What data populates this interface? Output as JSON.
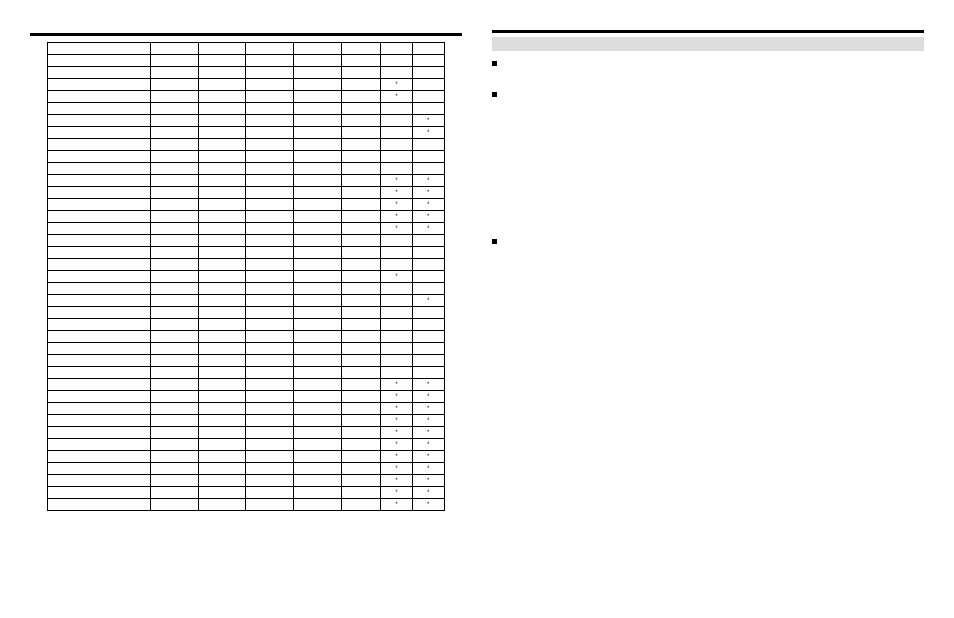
{
  "left": {
    "section": "",
    "caption": "",
    "rows": [
      {
        "name": "",
        "c1": "",
        "c2": "",
        "c3": "",
        "c4": "",
        "c5": "",
        "c6": "",
        "c7": ""
      },
      {
        "name": "",
        "c1": "",
        "c2": "",
        "c3": "",
        "c4": "",
        "c5": "",
        "c6": "",
        "c7": ""
      },
      {
        "name": "",
        "c1": "",
        "c2": "",
        "c3": "",
        "c4": "",
        "c5": "",
        "c6": "",
        "c7": ""
      },
      {
        "name": "",
        "c1": "",
        "c2": "",
        "c3": "",
        "c4": "",
        "c5": "",
        "c6": "*",
        "c7": ""
      },
      {
        "name": "",
        "c1": "",
        "c2": "",
        "c3": "",
        "c4": "",
        "c5": "",
        "c6": "*",
        "c7": ""
      },
      {
        "name": "",
        "c1": "",
        "c2": "",
        "c3": "",
        "c4": "",
        "c5": "",
        "c6": "",
        "c7": ""
      },
      {
        "name": "",
        "c1": "",
        "c2": "",
        "c3": "",
        "c4": "",
        "c5": "",
        "c6": "",
        "c7": "*"
      },
      {
        "name": "",
        "c1": "",
        "c2": "",
        "c3": "",
        "c4": "",
        "c5": "",
        "c6": "",
        "c7": "*"
      },
      {
        "name": "",
        "c1": "",
        "c2": "",
        "c3": "",
        "c4": "",
        "c5": "",
        "c6": "",
        "c7": ""
      },
      {
        "name": "",
        "c1": "",
        "c2": "",
        "c3": "",
        "c4": "",
        "c5": "",
        "c6": "",
        "c7": ""
      },
      {
        "name": "",
        "c1": "",
        "c2": "",
        "c3": "",
        "c4": "",
        "c5": "",
        "c6": "",
        "c7": ""
      },
      {
        "name": "",
        "c1": "",
        "c2": "",
        "c3": "",
        "c4": "",
        "c5": "",
        "c6": "*",
        "c7": "*"
      },
      {
        "name": "",
        "c1": "",
        "c2": "",
        "c3": "",
        "c4": "",
        "c5": "",
        "c6": "*",
        "c7": "*"
      },
      {
        "name": "",
        "c1": "",
        "c2": "",
        "c3": "",
        "c4": "",
        "c5": "",
        "c6": "*",
        "c7": "*"
      },
      {
        "name": "",
        "c1": "",
        "c2": "",
        "c3": "",
        "c4": "",
        "c5": "",
        "c6": "*",
        "c7": "*"
      },
      {
        "name": "",
        "c1": "",
        "c2": "",
        "c3": "",
        "c4": "",
        "c5": "",
        "c6": "*",
        "c7": "*"
      },
      {
        "name": "",
        "c1": "",
        "c2": "",
        "c3": "",
        "c4": "",
        "c5": "",
        "c6": "",
        "c7": ""
      },
      {
        "name": "",
        "c1": "",
        "c2": "",
        "c3": "",
        "c4": "",
        "c5": "",
        "c6": "",
        "c7": ""
      },
      {
        "name": "",
        "c1": "",
        "c2": "",
        "c3": "",
        "c4": "",
        "c5": "",
        "c6": "",
        "c7": ""
      },
      {
        "name": "",
        "c1": "",
        "c2": "",
        "c3": "",
        "c4": "",
        "c5": "",
        "c6": "*",
        "c7": ""
      },
      {
        "name": "",
        "c1": "",
        "c2": "",
        "c3": "",
        "c4": "",
        "c5": "",
        "c6": "",
        "c7": ""
      },
      {
        "name": "",
        "c1": "",
        "c2": "",
        "c3": "",
        "c4": "",
        "c5": "",
        "c6": "",
        "c7": "*"
      },
      {
        "name": "",
        "c1": "",
        "c2": "",
        "c3": "",
        "c4": "",
        "c5": "",
        "c6": "",
        "c7": ""
      },
      {
        "name": "",
        "c1": "",
        "c2": "",
        "c3": "",
        "c4": "",
        "c5": "",
        "c6": "",
        "c7": ""
      },
      {
        "name": "",
        "c1": "",
        "c2": "",
        "c3": "",
        "c4": "",
        "c5": "",
        "c6": "",
        "c7": ""
      },
      {
        "name": "",
        "c1": "",
        "c2": "",
        "c3": "",
        "c4": "",
        "c5": "",
        "c6": "",
        "c7": ""
      },
      {
        "name": "",
        "c1": "",
        "c2": "",
        "c3": "",
        "c4": "",
        "c5": "",
        "c6": "",
        "c7": ""
      },
      {
        "name": "",
        "c1": "",
        "c2": "",
        "c3": "",
        "c4": "",
        "c5": "",
        "c6": "",
        "c7": ""
      },
      {
        "name": "",
        "c1": "",
        "c2": "",
        "c3": "",
        "c4": "",
        "c5": "",
        "c6": "*",
        "c7": "*"
      },
      {
        "name": "",
        "c1": "",
        "c2": "",
        "c3": "",
        "c4": "",
        "c5": "",
        "c6": "*",
        "c7": "*"
      },
      {
        "name": "",
        "c1": "",
        "c2": "",
        "c3": "",
        "c4": "",
        "c5": "",
        "c6": "*",
        "c7": "*"
      },
      {
        "name": "",
        "c1": "",
        "c2": "",
        "c3": "",
        "c4": "",
        "c5": "",
        "c6": "*",
        "c7": "*"
      },
      {
        "name": "",
        "c1": "",
        "c2": "",
        "c3": "",
        "c4": "",
        "c5": "",
        "c6": "*",
        "c7": "*"
      },
      {
        "name": "",
        "c1": "",
        "c2": "",
        "c3": "",
        "c4": "",
        "c5": "",
        "c6": "*",
        "c7": "*"
      },
      {
        "name": "",
        "c1": "",
        "c2": "",
        "c3": "",
        "c4": "",
        "c5": "",
        "c6": "*",
        "c7": "*"
      },
      {
        "name": "",
        "c1": "",
        "c2": "",
        "c3": "",
        "c4": "",
        "c5": "",
        "c6": "*",
        "c7": "*"
      },
      {
        "name": "",
        "c1": "",
        "c2": "",
        "c3": "",
        "c4": "",
        "c5": "",
        "c6": "*",
        "c7": "*"
      },
      {
        "name": "",
        "c1": "",
        "c2": "",
        "c3": "",
        "c4": "",
        "c5": "",
        "c6": "*",
        "c7": "*"
      },
      {
        "name": "",
        "c1": "",
        "c2": "",
        "c3": "",
        "c4": "",
        "c5": "",
        "c6": "*",
        "c7": "*"
      }
    ]
  },
  "right": {
    "shade_label": "",
    "bullets": [
      {
        "text": ""
      },
      {
        "text": ""
      },
      {
        "text": ""
      }
    ]
  }
}
